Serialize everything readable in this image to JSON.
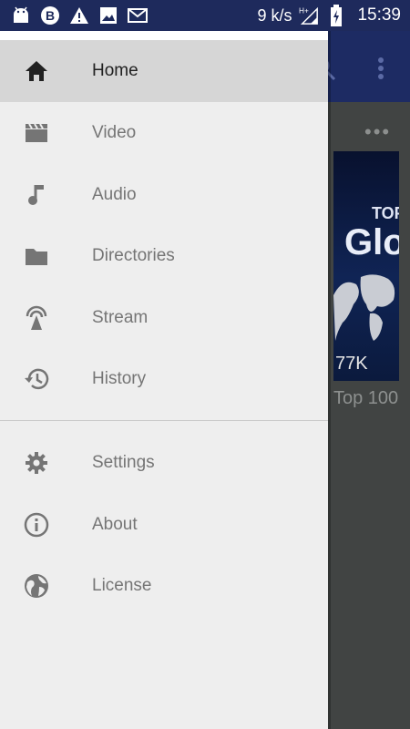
{
  "status_bar": {
    "left_icons": [
      "android-icon",
      "b-badge-icon",
      "warning-icon",
      "image-icon",
      "email-icon"
    ],
    "speed": "9 k/s",
    "network": "H+",
    "time": "15:39"
  },
  "background": {
    "dots": "•••",
    "thumbnail": {
      "title_top": "TOP",
      "title_main": "Glo",
      "views": "77K"
    },
    "item_title": "Top 100"
  },
  "drawer": {
    "items": [
      {
        "label": "Home",
        "icon": "home-icon",
        "active": true
      },
      {
        "label": "Video",
        "icon": "video-icon",
        "active": false
      },
      {
        "label": "Audio",
        "icon": "music-note-icon",
        "active": false
      },
      {
        "label": "Directories",
        "icon": "folder-icon",
        "active": false
      },
      {
        "label": "Stream",
        "icon": "stream-icon",
        "active": false
      },
      {
        "label": "History",
        "icon": "history-icon",
        "active": false
      }
    ],
    "secondary_items": [
      {
        "label": "Settings",
        "icon": "gear-icon"
      },
      {
        "label": "About",
        "icon": "info-icon"
      },
      {
        "label": "License",
        "icon": "globe-icon"
      }
    ]
  },
  "colors": {
    "status_bar": "#1e2a5c",
    "drawer_bg": "#eeeeee",
    "active_item": "#d6d6d6",
    "icon_gray": "#757575"
  }
}
